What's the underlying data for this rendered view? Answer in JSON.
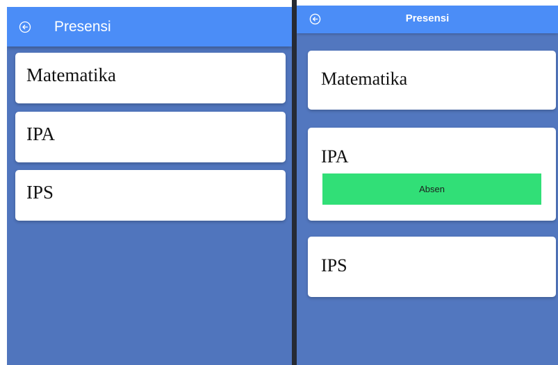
{
  "left_screen": {
    "appbar": {
      "title": "Presensi",
      "back_icon": "arrow-back-circle-icon"
    },
    "subjects": [
      {
        "name": "Matematika"
      },
      {
        "name": "IPA"
      },
      {
        "name": "IPS"
      }
    ]
  },
  "right_screen": {
    "appbar": {
      "title": "Presensi",
      "back_icon": "arrow-back-circle-icon"
    },
    "subjects": [
      {
        "name": "Matematika"
      },
      {
        "name": "IPA",
        "button_label": "Absen"
      },
      {
        "name": "IPS"
      }
    ]
  },
  "colors": {
    "appbar": "#4b8df7",
    "background": "#5075bd",
    "button": "#31df77",
    "divider": "#262a33",
    "card": "#ffffff"
  }
}
